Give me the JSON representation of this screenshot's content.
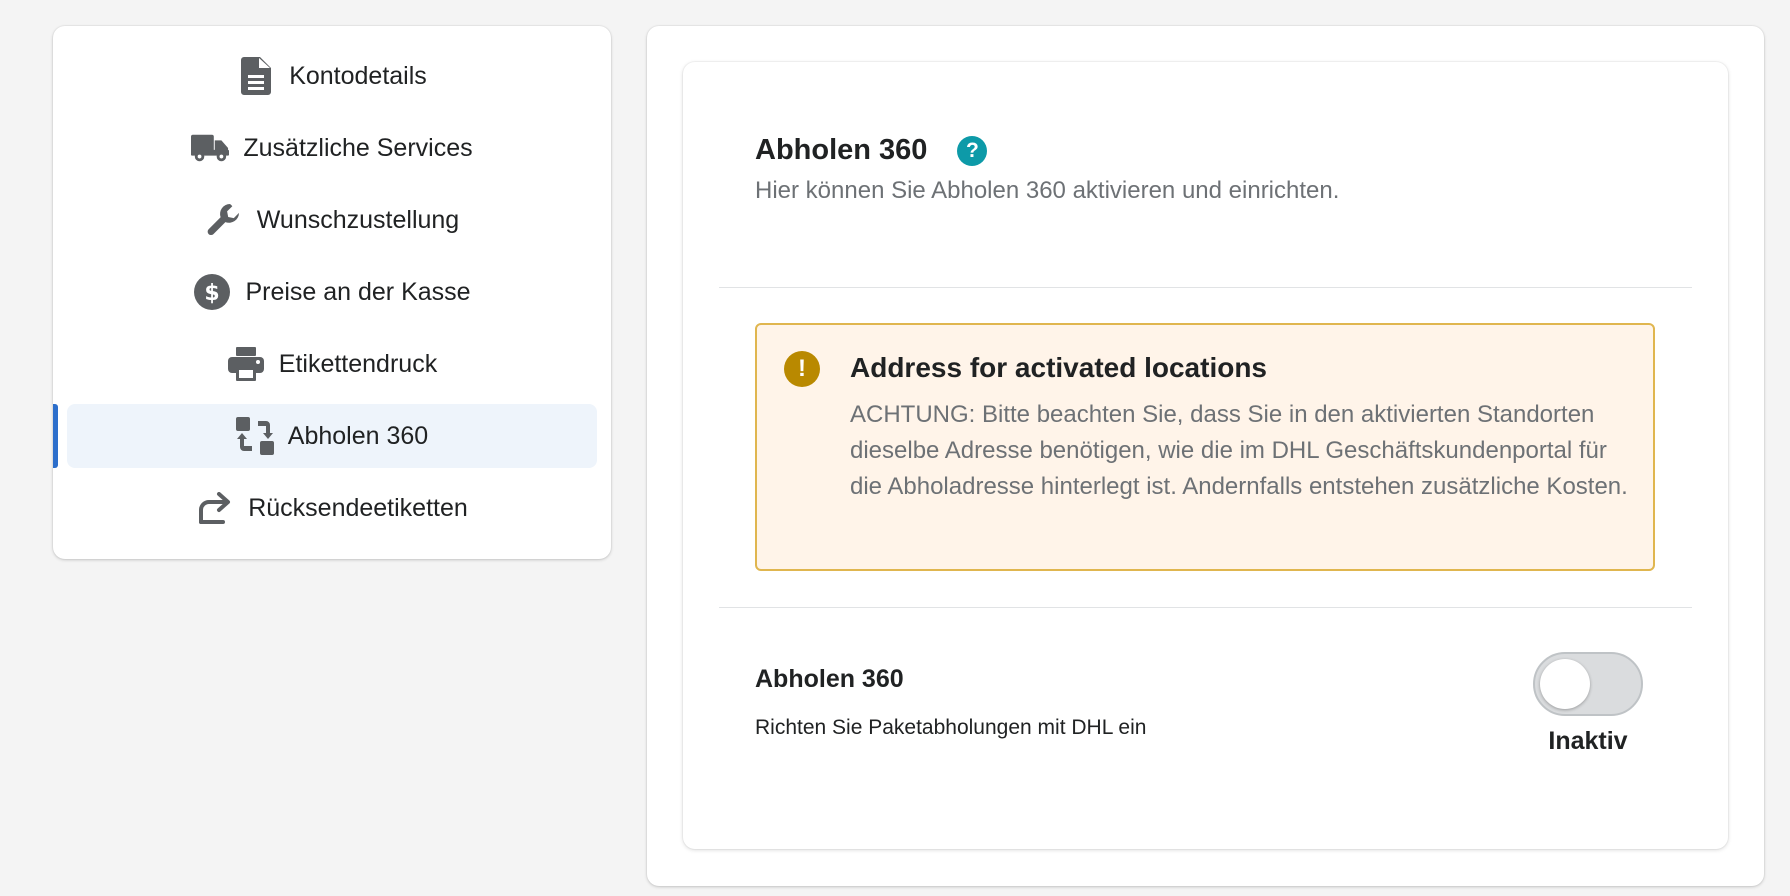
{
  "sidebar": {
    "items": [
      {
        "label": "Kontodetails",
        "icon": "document-icon",
        "active": false
      },
      {
        "label": "Zusätzliche Services",
        "icon": "truck-icon",
        "active": false
      },
      {
        "label": "Wunschzustellung",
        "icon": "wrench-icon",
        "active": false
      },
      {
        "label": "Preise an der Kasse",
        "icon": "dollar-icon",
        "active": false
      },
      {
        "label": "Etikettendruck",
        "icon": "printer-icon",
        "active": false
      },
      {
        "label": "Abholen 360",
        "icon": "exchange-icon",
        "active": true
      },
      {
        "label": "Rücksendeetiketten",
        "icon": "return-arrow-icon",
        "active": false
      }
    ]
  },
  "section": {
    "title": "Abholen 360",
    "subtitle": "Hier können Sie Abholen 360 aktivieren und einrichten.",
    "help_icon": "question-icon"
  },
  "banner": {
    "icon": "exclamation-icon",
    "title": "Address for activated locations",
    "text": "ACHTUNG: Bitte beachten Sie, dass Sie in den aktivierten Standorten dieselbe Adresse benötigen, wie die im DHL Geschäftskundenportal für die Abholadresse hinterlegt ist. Andernfalls entstehen zusätzliche Kosten."
  },
  "setting": {
    "title": "Abholen 360",
    "description": "Richten Sie Paketabholungen mit DHL ein",
    "toggle_on": false,
    "status_label": "Inaktiv"
  },
  "colors": {
    "accent": "#2c6ecb",
    "help": "#0d9aa8",
    "warning_border": "#e0b64f",
    "warning_bg": "#fff4e9",
    "warning_icon": "#b98900"
  }
}
